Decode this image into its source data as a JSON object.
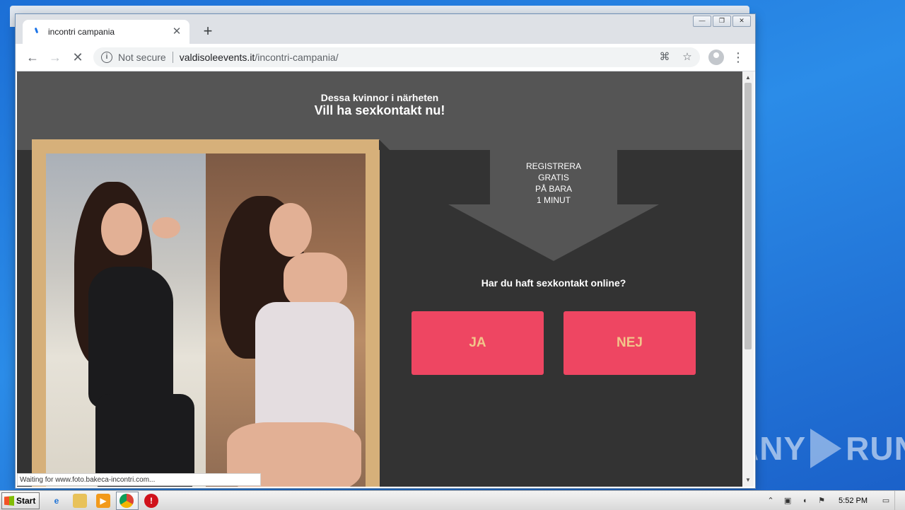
{
  "browser": {
    "tab_title": "incontri campania",
    "security_label": "Not secure",
    "url_host": "valdisoleevents.it",
    "url_path": "/incontri-campania/"
  },
  "page": {
    "hero_subtitle": "Dessa kvinnor i närheten",
    "hero_title": "Vill ha sexkontakt nu!",
    "arrow_lines": [
      "REGISTRERA",
      "GRATIS",
      "PÅ BARA",
      "1 MINUT"
    ],
    "question": "Har du haft sexkontakt online?",
    "yes_label": "JA",
    "no_label": "NEJ",
    "button_color": "#ee4662",
    "button_text_color": "#f2c58a",
    "frame_color": "#d6b07a"
  },
  "status_text": "Waiting for www.foto.bakeca-incontri.com...",
  "taskbar": {
    "start_label": "Start",
    "clock": "5:52 PM"
  },
  "watermark": {
    "left": "ANY",
    "right": "RUN"
  }
}
